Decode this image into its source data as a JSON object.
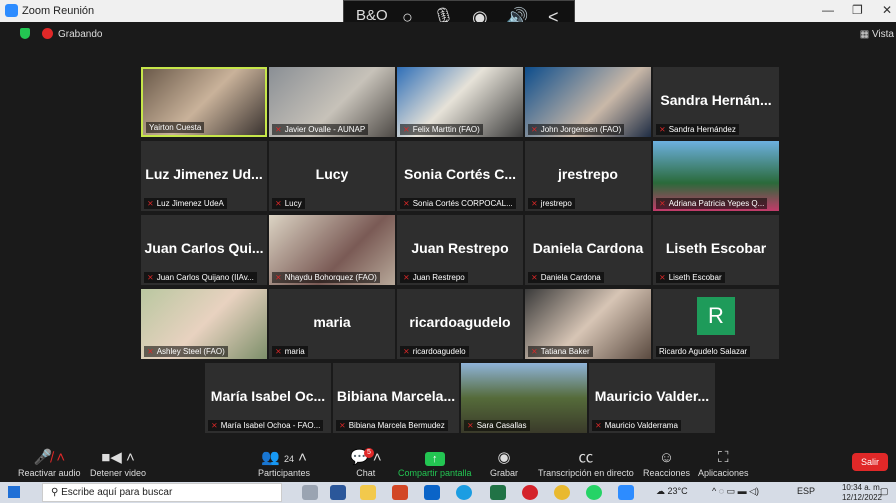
{
  "window": {
    "title": "Zoom Reunión"
  },
  "media_controls": [
    "B&O",
    "○",
    "mic",
    "◉",
    "speaker",
    "<"
  ],
  "recording": {
    "label": "Grabando"
  },
  "view_button": "Vista",
  "participants_tiles": [
    {
      "tag": "Yairton Cuesta",
      "display": "",
      "muted": false,
      "active": true
    },
    {
      "tag": "Javier Ovalle - AUNAP",
      "display": "",
      "muted": true
    },
    {
      "tag": "Felix Marttin (FAO)",
      "display": "",
      "muted": true
    },
    {
      "tag": "John Jorgensen (FAO)",
      "display": "",
      "muted": true
    },
    {
      "tag": "Sandra Hernández",
      "display": "Sandra Hernán...",
      "muted": true
    },
    {
      "tag": "Luz Jimenez UdeA",
      "display": "Luz Jimenez Ud...",
      "muted": true
    },
    {
      "tag": "Lucy",
      "display": "Lucy",
      "muted": true
    },
    {
      "tag": "Sonia Cortés CORPOCAL...",
      "display": "Sonia Cortés C...",
      "muted": true
    },
    {
      "tag": "jrestrepo",
      "display": "jrestrepo",
      "muted": true
    },
    {
      "tag": "Adriana Patricia Yepes Q...",
      "display": "",
      "muted": true
    },
    {
      "tag": "Juan Carlos Quijano (IIAv...",
      "display": "Juan Carlos Qui...",
      "muted": true
    },
    {
      "tag": "Nhaydu Bohorquez (FAO)",
      "display": "",
      "muted": true
    },
    {
      "tag": "Juan Restrepo",
      "display": "Juan Restrepo",
      "muted": true
    },
    {
      "tag": "Daniela Cardona",
      "display": "Daniela Cardona",
      "muted": true
    },
    {
      "tag": "Liseth Escobar",
      "display": "Liseth Escobar",
      "muted": true
    },
    {
      "tag": "Ashley Steel (FAO)",
      "display": "",
      "muted": true
    },
    {
      "tag": "maria",
      "display": "maria",
      "muted": true
    },
    {
      "tag": "ricardoagudelo",
      "display": "ricardoagudelo",
      "muted": true
    },
    {
      "tag": "Tatiana Baker",
      "display": "",
      "muted": true
    },
    {
      "tag": "Ricardo Agudelo Salazar",
      "display": "",
      "muted": false,
      "avatar_letter": "R"
    },
    {
      "tag": "María Isabel Ochoa - FAO...",
      "display": "María Isabel Oc...",
      "muted": true
    },
    {
      "tag": "Bibiana Marcela Bermudez",
      "display": "Bibiana Marcela...",
      "muted": true
    },
    {
      "tag": "Sara Casallas",
      "display": "",
      "muted": true
    },
    {
      "tag": "Mauricio Valderrama",
      "display": "Mauricio Valder...",
      "muted": true
    }
  ],
  "toolbar": {
    "unmute": "Reactivar audio",
    "stop_video": "Detener video",
    "participants": "Participantes",
    "participants_count": "24",
    "chat": "Chat",
    "chat_badge": "5",
    "share": "Compartir pantalla",
    "record": "Grabar",
    "transcript": "Transcripción en directo",
    "reactions": "Reacciones",
    "apps": "Aplicaciones",
    "leave": "Salir"
  },
  "taskbar": {
    "search_placeholder": "Escribe aquí para buscar",
    "temperature": "23°C",
    "language": "ESP",
    "time": "10:34 a. m.",
    "date": "12/12/2022",
    "notif": "20"
  },
  "colors": {
    "accent_green": "#23c552",
    "mute_red": "#e02828",
    "active_border": "#c6e64a",
    "zoom_blue": "#2d8cff"
  }
}
